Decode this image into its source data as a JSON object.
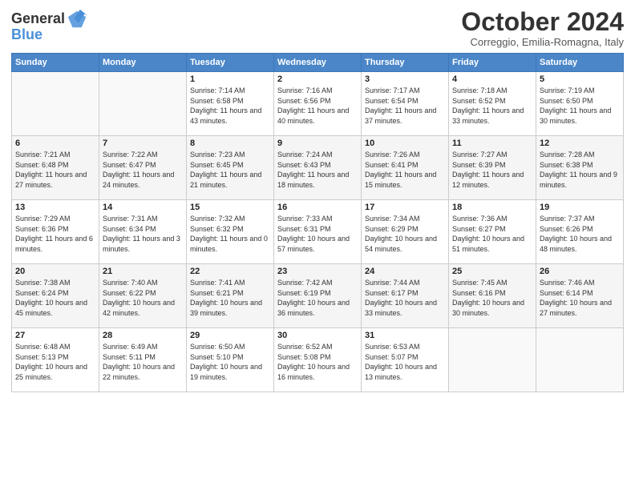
{
  "header": {
    "logo_line1": "General",
    "logo_line2": "Blue",
    "month": "October 2024",
    "location": "Correggio, Emilia-Romagna, Italy"
  },
  "weekdays": [
    "Sunday",
    "Monday",
    "Tuesday",
    "Wednesday",
    "Thursday",
    "Friday",
    "Saturday"
  ],
  "weeks": [
    [
      {
        "day": "",
        "sunrise": "",
        "sunset": "",
        "daylight": ""
      },
      {
        "day": "",
        "sunrise": "",
        "sunset": "",
        "daylight": ""
      },
      {
        "day": "1",
        "sunrise": "Sunrise: 7:14 AM",
        "sunset": "Sunset: 6:58 PM",
        "daylight": "Daylight: 11 hours and 43 minutes."
      },
      {
        "day": "2",
        "sunrise": "Sunrise: 7:16 AM",
        "sunset": "Sunset: 6:56 PM",
        "daylight": "Daylight: 11 hours and 40 minutes."
      },
      {
        "day": "3",
        "sunrise": "Sunrise: 7:17 AM",
        "sunset": "Sunset: 6:54 PM",
        "daylight": "Daylight: 11 hours and 37 minutes."
      },
      {
        "day": "4",
        "sunrise": "Sunrise: 7:18 AM",
        "sunset": "Sunset: 6:52 PM",
        "daylight": "Daylight: 11 hours and 33 minutes."
      },
      {
        "day": "5",
        "sunrise": "Sunrise: 7:19 AM",
        "sunset": "Sunset: 6:50 PM",
        "daylight": "Daylight: 11 hours and 30 minutes."
      }
    ],
    [
      {
        "day": "6",
        "sunrise": "Sunrise: 7:21 AM",
        "sunset": "Sunset: 6:48 PM",
        "daylight": "Daylight: 11 hours and 27 minutes."
      },
      {
        "day": "7",
        "sunrise": "Sunrise: 7:22 AM",
        "sunset": "Sunset: 6:47 PM",
        "daylight": "Daylight: 11 hours and 24 minutes."
      },
      {
        "day": "8",
        "sunrise": "Sunrise: 7:23 AM",
        "sunset": "Sunset: 6:45 PM",
        "daylight": "Daylight: 11 hours and 21 minutes."
      },
      {
        "day": "9",
        "sunrise": "Sunrise: 7:24 AM",
        "sunset": "Sunset: 6:43 PM",
        "daylight": "Daylight: 11 hours and 18 minutes."
      },
      {
        "day": "10",
        "sunrise": "Sunrise: 7:26 AM",
        "sunset": "Sunset: 6:41 PM",
        "daylight": "Daylight: 11 hours and 15 minutes."
      },
      {
        "day": "11",
        "sunrise": "Sunrise: 7:27 AM",
        "sunset": "Sunset: 6:39 PM",
        "daylight": "Daylight: 11 hours and 12 minutes."
      },
      {
        "day": "12",
        "sunrise": "Sunrise: 7:28 AM",
        "sunset": "Sunset: 6:38 PM",
        "daylight": "Daylight: 11 hours and 9 minutes."
      }
    ],
    [
      {
        "day": "13",
        "sunrise": "Sunrise: 7:29 AM",
        "sunset": "Sunset: 6:36 PM",
        "daylight": "Daylight: 11 hours and 6 minutes."
      },
      {
        "day": "14",
        "sunrise": "Sunrise: 7:31 AM",
        "sunset": "Sunset: 6:34 PM",
        "daylight": "Daylight: 11 hours and 3 minutes."
      },
      {
        "day": "15",
        "sunrise": "Sunrise: 7:32 AM",
        "sunset": "Sunset: 6:32 PM",
        "daylight": "Daylight: 11 hours and 0 minutes."
      },
      {
        "day": "16",
        "sunrise": "Sunrise: 7:33 AM",
        "sunset": "Sunset: 6:31 PM",
        "daylight": "Daylight: 10 hours and 57 minutes."
      },
      {
        "day": "17",
        "sunrise": "Sunrise: 7:34 AM",
        "sunset": "Sunset: 6:29 PM",
        "daylight": "Daylight: 10 hours and 54 minutes."
      },
      {
        "day": "18",
        "sunrise": "Sunrise: 7:36 AM",
        "sunset": "Sunset: 6:27 PM",
        "daylight": "Daylight: 10 hours and 51 minutes."
      },
      {
        "day": "19",
        "sunrise": "Sunrise: 7:37 AM",
        "sunset": "Sunset: 6:26 PM",
        "daylight": "Daylight: 10 hours and 48 minutes."
      }
    ],
    [
      {
        "day": "20",
        "sunrise": "Sunrise: 7:38 AM",
        "sunset": "Sunset: 6:24 PM",
        "daylight": "Daylight: 10 hours and 45 minutes."
      },
      {
        "day": "21",
        "sunrise": "Sunrise: 7:40 AM",
        "sunset": "Sunset: 6:22 PM",
        "daylight": "Daylight: 10 hours and 42 minutes."
      },
      {
        "day": "22",
        "sunrise": "Sunrise: 7:41 AM",
        "sunset": "Sunset: 6:21 PM",
        "daylight": "Daylight: 10 hours and 39 minutes."
      },
      {
        "day": "23",
        "sunrise": "Sunrise: 7:42 AM",
        "sunset": "Sunset: 6:19 PM",
        "daylight": "Daylight: 10 hours and 36 minutes."
      },
      {
        "day": "24",
        "sunrise": "Sunrise: 7:44 AM",
        "sunset": "Sunset: 6:17 PM",
        "daylight": "Daylight: 10 hours and 33 minutes."
      },
      {
        "day": "25",
        "sunrise": "Sunrise: 7:45 AM",
        "sunset": "Sunset: 6:16 PM",
        "daylight": "Daylight: 10 hours and 30 minutes."
      },
      {
        "day": "26",
        "sunrise": "Sunrise: 7:46 AM",
        "sunset": "Sunset: 6:14 PM",
        "daylight": "Daylight: 10 hours and 27 minutes."
      }
    ],
    [
      {
        "day": "27",
        "sunrise": "Sunrise: 6:48 AM",
        "sunset": "Sunset: 5:13 PM",
        "daylight": "Daylight: 10 hours and 25 minutes."
      },
      {
        "day": "28",
        "sunrise": "Sunrise: 6:49 AM",
        "sunset": "Sunset: 5:11 PM",
        "daylight": "Daylight: 10 hours and 22 minutes."
      },
      {
        "day": "29",
        "sunrise": "Sunrise: 6:50 AM",
        "sunset": "Sunset: 5:10 PM",
        "daylight": "Daylight: 10 hours and 19 minutes."
      },
      {
        "day": "30",
        "sunrise": "Sunrise: 6:52 AM",
        "sunset": "Sunset: 5:08 PM",
        "daylight": "Daylight: 10 hours and 16 minutes."
      },
      {
        "day": "31",
        "sunrise": "Sunrise: 6:53 AM",
        "sunset": "Sunset: 5:07 PM",
        "daylight": "Daylight: 10 hours and 13 minutes."
      },
      {
        "day": "",
        "sunrise": "",
        "sunset": "",
        "daylight": ""
      },
      {
        "day": "",
        "sunrise": "",
        "sunset": "",
        "daylight": ""
      }
    ]
  ]
}
